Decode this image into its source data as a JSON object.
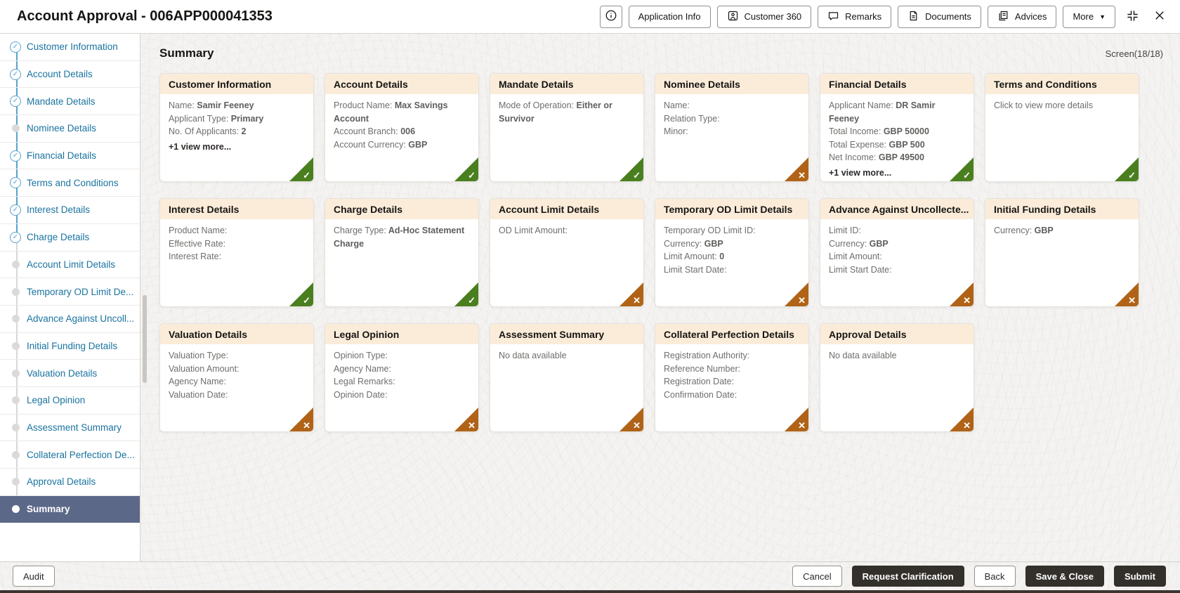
{
  "header": {
    "title": "Account Approval - 006APP000041353",
    "buttons": [
      {
        "icon": "info-icon",
        "label": ""
      },
      {
        "icon": "",
        "label": "Application Info"
      },
      {
        "icon": "customer-360-icon",
        "label": "Customer 360"
      },
      {
        "icon": "remarks-icon",
        "label": "Remarks"
      },
      {
        "icon": "documents-icon",
        "label": "Documents"
      },
      {
        "icon": "advices-icon",
        "label": "Advices"
      },
      {
        "icon": "caret-down-icon",
        "label": "More"
      }
    ],
    "window_controls": [
      {
        "icon": "collapse-icon"
      },
      {
        "icon": "close-icon"
      }
    ]
  },
  "sidebar": {
    "items": [
      {
        "label": "Customer Information",
        "state": "completed"
      },
      {
        "label": "Account Details",
        "state": "completed"
      },
      {
        "label": "Mandate Details",
        "state": "completed"
      },
      {
        "label": "Nominee Details",
        "state": "pending"
      },
      {
        "label": "Financial Details",
        "state": "completed"
      },
      {
        "label": "Terms and Conditions",
        "state": "completed"
      },
      {
        "label": "Interest Details",
        "state": "completed"
      },
      {
        "label": "Charge Details",
        "state": "completed"
      },
      {
        "label": "Account Limit Details",
        "state": "pending"
      },
      {
        "label": "Temporary OD Limit De...",
        "state": "pending"
      },
      {
        "label": "Advance Against Uncoll...",
        "state": "pending"
      },
      {
        "label": "Initial Funding Details",
        "state": "pending"
      },
      {
        "label": "Valuation Details",
        "state": "pending"
      },
      {
        "label": "Legal Opinion",
        "state": "pending"
      },
      {
        "label": "Assessment Summary",
        "state": "pending"
      },
      {
        "label": "Collateral Perfection De...",
        "state": "pending"
      },
      {
        "label": "Approval Details",
        "state": "pending"
      },
      {
        "label": "Summary",
        "state": "current"
      }
    ]
  },
  "main": {
    "title": "Summary",
    "screen_indicator": "Screen(18/18)",
    "cards": [
      {
        "title": "Customer Information",
        "status": "success",
        "lines": [
          {
            "label": "Name:",
            "value": "Samir Feeney"
          },
          {
            "label": "Applicant Type:",
            "value": "Primary"
          },
          {
            "label": "No. Of Applicants:",
            "value": "2"
          }
        ],
        "more": "+1 view more..."
      },
      {
        "title": "Account Details",
        "status": "success",
        "lines": [
          {
            "label": "Product Name:",
            "value": "Max Savings Account"
          },
          {
            "label": "Account Branch:",
            "value": "006"
          },
          {
            "label": "Account Currency:",
            "value": "GBP"
          }
        ]
      },
      {
        "title": "Mandate Details",
        "status": "success",
        "lines": [
          {
            "label": "Mode of Operation:",
            "value": "Either or Survivor"
          }
        ]
      },
      {
        "title": "Nominee Details",
        "status": "error",
        "lines": [
          {
            "label": "Name:",
            "value": ""
          },
          {
            "label": "Relation Type:",
            "value": ""
          },
          {
            "label": "Minor:",
            "value": ""
          }
        ]
      },
      {
        "title": "Financial Details",
        "status": "success",
        "lines": [
          {
            "label": "Applicant Name:",
            "value": "DR Samir Feeney"
          },
          {
            "label": "Total Income:",
            "value": "GBP 50000"
          },
          {
            "label": "Total Expense:",
            "value": "GBP 500"
          },
          {
            "label": "Net Income:",
            "value": "GBP 49500"
          }
        ],
        "more": "+1 view more..."
      },
      {
        "title": "Terms and Conditions",
        "status": "success",
        "note": "Click to view more details"
      },
      {
        "title": "Interest Details",
        "status": "success",
        "lines": [
          {
            "label": "Product Name:",
            "value": ""
          },
          {
            "label": "Effective Rate:",
            "value": ""
          },
          {
            "label": "Interest Rate:",
            "value": ""
          }
        ]
      },
      {
        "title": "Charge Details",
        "status": "success",
        "lines": [
          {
            "label": "Charge Type:",
            "value": "Ad-Hoc Statement Charge"
          }
        ]
      },
      {
        "title": "Account Limit Details",
        "status": "error",
        "lines": [
          {
            "label": "OD Limit Amount:",
            "value": ""
          }
        ]
      },
      {
        "title": "Temporary OD Limit Details",
        "status": "error",
        "lines": [
          {
            "label": "Temporary OD Limit ID:",
            "value": ""
          },
          {
            "label": "Currency:",
            "value": "GBP"
          },
          {
            "label": "Limit Amount:",
            "value": "0"
          },
          {
            "label": "Limit Start Date:",
            "value": ""
          }
        ]
      },
      {
        "title": "Advance Against Uncollecte...",
        "status": "error",
        "lines": [
          {
            "label": "Limit ID:",
            "value": ""
          },
          {
            "label": "Currency:",
            "value": "GBP"
          },
          {
            "label": "Limit Amount:",
            "value": ""
          },
          {
            "label": "Limit Start Date:",
            "value": ""
          }
        ]
      },
      {
        "title": "Initial Funding Details",
        "status": "error",
        "lines": [
          {
            "label": "Currency:",
            "value": "GBP"
          }
        ]
      },
      {
        "title": "Valuation Details",
        "status": "error",
        "lines": [
          {
            "label": "Valuation Type:",
            "value": ""
          },
          {
            "label": "Valuation Amount:",
            "value": ""
          },
          {
            "label": "Agency Name:",
            "value": ""
          },
          {
            "label": "Valuation Date:",
            "value": ""
          }
        ]
      },
      {
        "title": "Legal Opinion",
        "status": "error",
        "lines": [
          {
            "label": "Opinion Type:",
            "value": ""
          },
          {
            "label": "Agency Name:",
            "value": ""
          },
          {
            "label": "Legal Remarks:",
            "value": ""
          },
          {
            "label": "Opinion Date:",
            "value": ""
          }
        ]
      },
      {
        "title": "Assessment Summary",
        "status": "error",
        "note": "No data available"
      },
      {
        "title": "Collateral Perfection Details",
        "status": "error",
        "lines": [
          {
            "label": "Registration Authority:",
            "value": ""
          },
          {
            "label": "Reference Number:",
            "value": ""
          },
          {
            "label": "Registration Date:",
            "value": ""
          },
          {
            "label": "Confirmation Date:",
            "value": ""
          }
        ]
      },
      {
        "title": "Approval Details",
        "status": "error",
        "note": "No data available"
      }
    ]
  },
  "footer": {
    "audit_label": "Audit",
    "actions": [
      {
        "label": "Cancel",
        "style": "outlined"
      },
      {
        "label": "Request Clarification",
        "style": "solid"
      },
      {
        "label": "Back",
        "style": "outlined"
      },
      {
        "label": "Save & Close",
        "style": "solid"
      },
      {
        "label": "Submit",
        "style": "solid"
      }
    ]
  },
  "status_glyphs": {
    "success": "✓",
    "error": "✕"
  },
  "colors": {
    "card_header_bg": "#fbecd9",
    "success_badge": "#4a7f1f",
    "error_badge": "#b06317",
    "sidebar_link": "#1a739f",
    "sidebar_selected_bg": "#5c6888",
    "primary_button_bg": "#33302c"
  }
}
